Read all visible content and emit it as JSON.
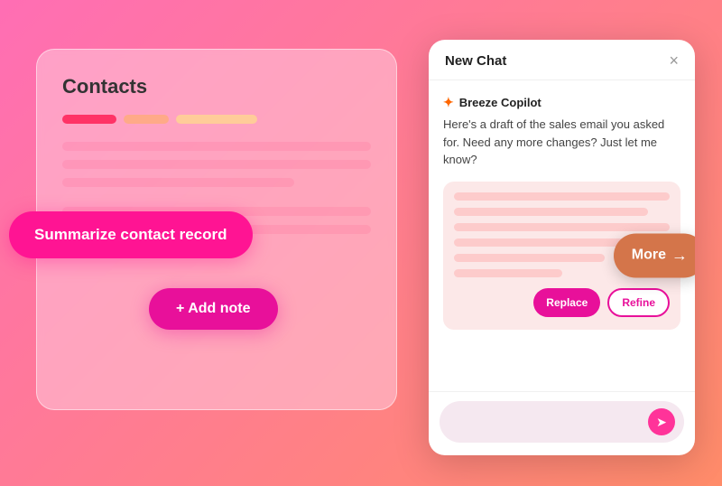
{
  "contacts_card": {
    "title": "Contacts",
    "bars": [
      "red",
      "orange-short",
      "orange-long"
    ]
  },
  "summarize_btn": {
    "label": "Summarize contact record"
  },
  "add_note_btn": {
    "label": "+ Add note"
  },
  "more_badge": {
    "label": "More",
    "arrow": "→"
  },
  "chat_panel": {
    "header": {
      "title": "New Chat",
      "close_label": "×"
    },
    "breeze": {
      "name": "Breeze Copilot",
      "message": "Here's a draft of the sales email you asked for. Need any more changes? Just let me know?"
    },
    "draft_actions": {
      "replace_label": "Replace",
      "refine_label": "Refine"
    },
    "input": {
      "placeholder": ""
    },
    "send_icon": "➤"
  }
}
